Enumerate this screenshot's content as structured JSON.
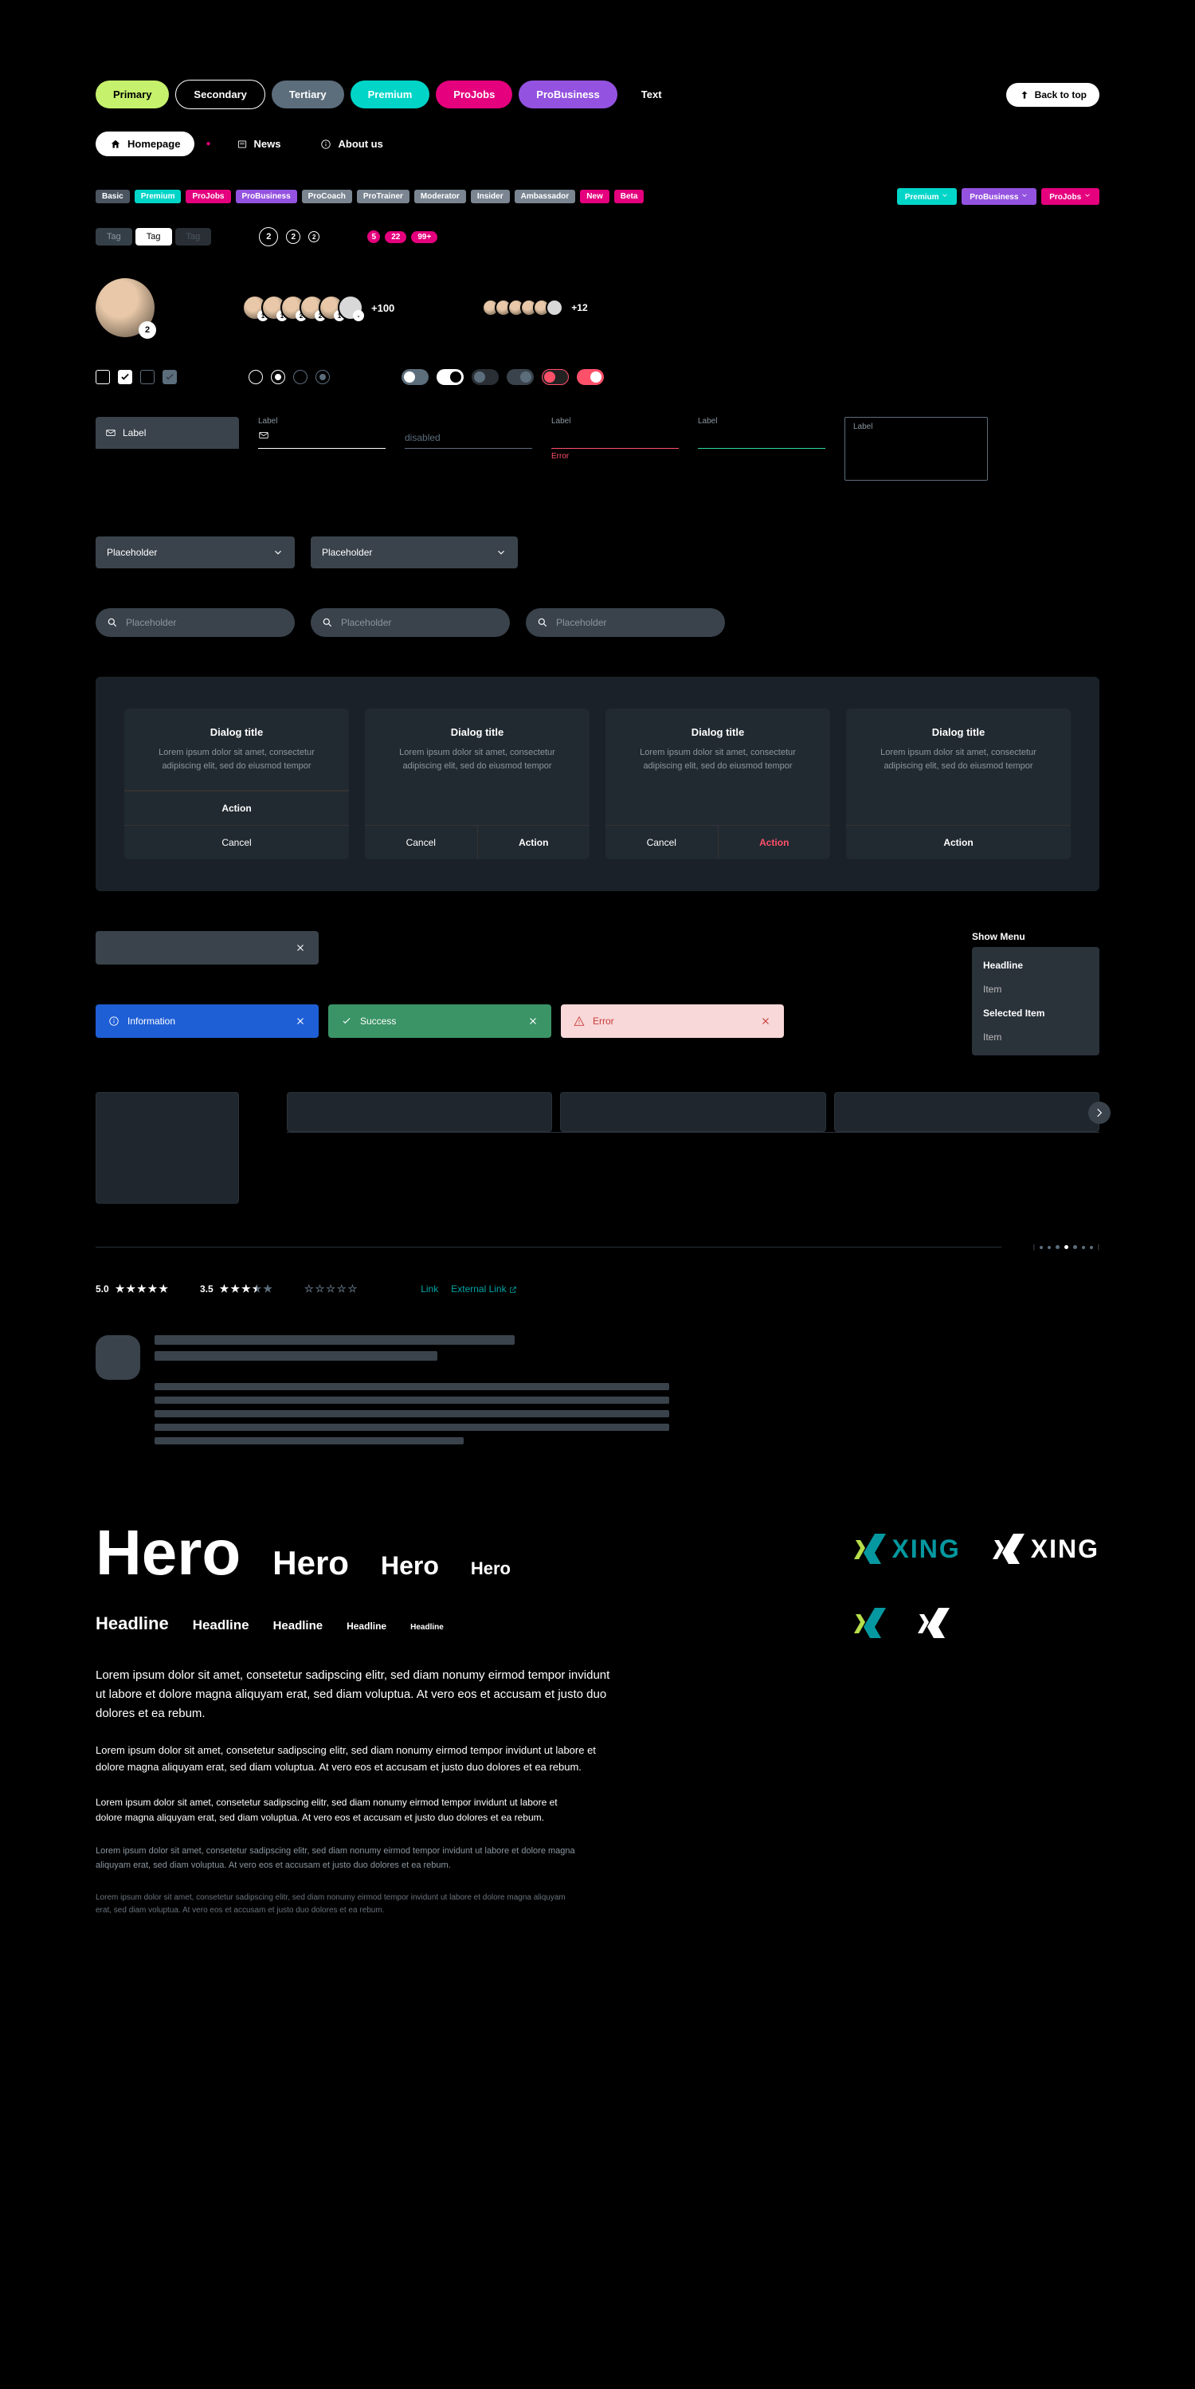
{
  "buttons": {
    "primary": "Primary",
    "secondary": "Secondary",
    "tertiary": "Tertiary",
    "premium": "Premium",
    "projobs": "ProJobs",
    "probusiness": "ProBusiness",
    "text": "Text",
    "back_to_top": "Back to top"
  },
  "nav": {
    "homepage": "Homepage",
    "news": "News",
    "about": "About us"
  },
  "badges": {
    "basic": "Basic",
    "premium": "Premium",
    "projobs": "ProJobs",
    "probusiness": "ProBusiness",
    "procoach": "ProCoach",
    "protrainer": "ProTrainer",
    "moderator": "Moderator",
    "insider": "Insider",
    "ambassador": "Ambassador",
    "new": "New",
    "beta": "Beta",
    "premium_dd": "Premium",
    "probusiness_dd": "ProBusiness",
    "projobs_dd": "ProJobs"
  },
  "tags": {
    "t1": "Tag",
    "t2": "Tag",
    "t3": "Tag"
  },
  "counters": {
    "c1": "2",
    "c2": "2",
    "c3": "2",
    "p1": "5",
    "p2": "22",
    "p3": "99+"
  },
  "avatars": {
    "lg_badge": "2",
    "facepile_a": [
      "1",
      "1",
      "2",
      "2",
      "1",
      "-"
    ],
    "count_a": "+100",
    "count_b": "+12"
  },
  "form": {
    "label": "Label",
    "label2": "Label",
    "disabled": "disabled",
    "error_label": "Label",
    "error": "Error",
    "correct_label": "Label",
    "textarea_label": "Label"
  },
  "dropdown": {
    "a": "Placeholder"
  },
  "search": {
    "placeholder": "Placeholder"
  },
  "dialogs": {
    "d1": {
      "title": "Dialog title",
      "text": "Lorem ipsum dolor sit amet, consectetur adipiscing elit, sed do eiusmod tempor",
      "action": "Action",
      "cancel": "Cancel"
    },
    "d2": {
      "title": "Dialog title",
      "text": "Lorem ipsum dolor sit amet, consectetur adipiscing elit, sed do eiusmod tempor",
      "action": "Action",
      "cancel": "Cancel"
    },
    "d3": {
      "title": "Dialog title",
      "text": "Lorem ipsum dolor sit amet, consectetur adipiscing elit, sed do eiusmod tempor",
      "action": "Action",
      "cancel": "Cancel"
    },
    "d4": {
      "title": "Dialog title",
      "text": "Lorem ipsum dolor sit amet, consectetur adipiscing elit, sed do eiusmod tempor",
      "action": "Action"
    }
  },
  "alerts": {
    "info": "Information",
    "success": "Success",
    "error": "Error"
  },
  "menu": {
    "title": "Show Menu",
    "headline": "Headline",
    "i1": "Item",
    "selected": "Selected Item",
    "i2": "Item"
  },
  "ratings": {
    "r1": "5.0",
    "r2": "3.5"
  },
  "links": {
    "l1": "Link",
    "l2": "External Link"
  },
  "typo": {
    "hero": "Hero",
    "headline": "Headline",
    "body1": "Lorem ipsum dolor sit amet, consetetur sadipscing elitr, sed diam nonumy eirmod tempor invidunt ut labore et dolore magna aliquyam erat, sed diam voluptua. At vero eos et accusam et justo duo dolores et ea rebum.",
    "body2": "Lorem ipsum dolor sit amet, consetetur sadipscing elitr, sed diam nonumy eirmod tempor invidunt ut labore et dolore magna aliquyam erat, sed diam voluptua. At vero eos et accusam et justo duo dolores et ea rebum.",
    "body3": "Lorem ipsum dolor sit amet, consetetur sadipscing elitr, sed diam nonumy eirmod tempor invidunt ut labore et dolore magna aliquyam erat, sed diam voluptua. At vero eos et accusam et justo duo dolores et ea rebum.",
    "body4": "Lorem ipsum dolor sit amet, consetetur sadipscing elitr, sed diam nonumy eirmod tempor invidunt ut labore et dolore magna aliquyam erat, sed diam voluptua. At vero eos et accusam et justo duo dolores et ea rebum.",
    "body5": "Lorem ipsum dolor sit amet, consetetur sadipscing elitr, sed diam nonumy eirmod tempor invidunt ut labore et dolore magna aliquyam erat, sed diam voluptua. At vero eos et accusam et justo duo dolores et ea rebum."
  },
  "brand": {
    "name": "XING"
  }
}
